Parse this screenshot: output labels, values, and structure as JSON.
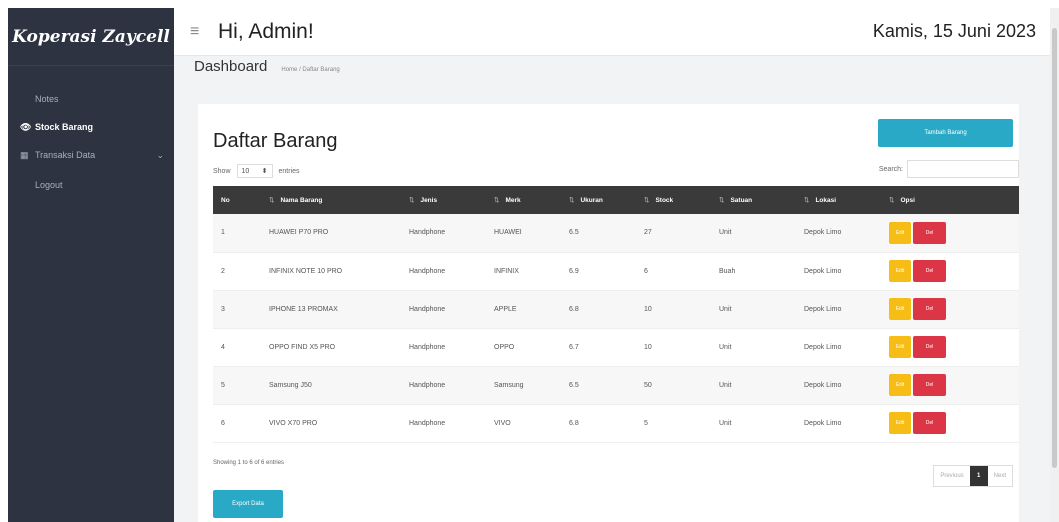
{
  "sidebar": {
    "brand": "Koperasi Zaycell",
    "items": [
      {
        "label": "Notes",
        "icon": "",
        "active": false
      },
      {
        "label": "Stock Barang",
        "icon": "eye-icon",
        "active": true
      },
      {
        "label": "Transaksi Data",
        "icon": "table-icon",
        "active": false,
        "has_chevron": true
      },
      {
        "label": "Logout",
        "icon": "",
        "active": false
      }
    ]
  },
  "topbar": {
    "greeting": "Hi, Admin!",
    "date": "Kamis, 15 Juni 2023"
  },
  "breadcrumb": {
    "title": "Dashboard",
    "path": "Home / Daftar Barang"
  },
  "card": {
    "title": "Daftar Barang",
    "add_button": "Tambah Barang",
    "show_label": "Show",
    "show_value": "10",
    "entries_label": "entries",
    "search_label": "Search:",
    "search_value": ""
  },
  "table": {
    "headers": [
      "No",
      "Nama Barang",
      "Jenis",
      "Merk",
      "Ukuran",
      "Stock",
      "Satuan",
      "Lokasi",
      "Opsi"
    ],
    "rows": [
      [
        "1",
        "HUAWEI P70 PRO",
        "Handphone",
        "HUAWEI",
        "6.5",
        "27",
        "Unit",
        "Depok Limo"
      ],
      [
        "2",
        "INFINIX NOTE 10 PRO",
        "Handphone",
        "INFINIX",
        "6.9",
        "6",
        "Buah",
        "Depok Limo"
      ],
      [
        "3",
        "IPHONE 13 PROMAX",
        "Handphone",
        "APPLE",
        "6.8",
        "10",
        "Unit",
        "Depok Limo"
      ],
      [
        "4",
        "OPPO FIND X5 PRO",
        "Handphone",
        "OPPO",
        "6.7",
        "10",
        "Unit",
        "Depok Limo"
      ],
      [
        "5",
        "Samsung J50",
        "Handphone",
        "Samsung",
        "6.5",
        "50",
        "Unit",
        "Depok Limo"
      ],
      [
        "6",
        "VIVO X70 PRO",
        "Handphone",
        "VIVO",
        "6.8",
        "5",
        "Unit",
        "Depok Limo"
      ]
    ],
    "edit_label": "Edit",
    "delete_label": "Del"
  },
  "footer": {
    "info": "Showing 1 to 6 of 6 entries",
    "previous": "Previous",
    "current_page": "1",
    "next": "Next",
    "export_button": "Export Data"
  },
  "colors": {
    "sidebar_bg": "#2d3340",
    "accent": "#2aa9c7",
    "edit": "#f6bd16",
    "delete": "#dc3545",
    "table_header": "#3a3a3a"
  }
}
